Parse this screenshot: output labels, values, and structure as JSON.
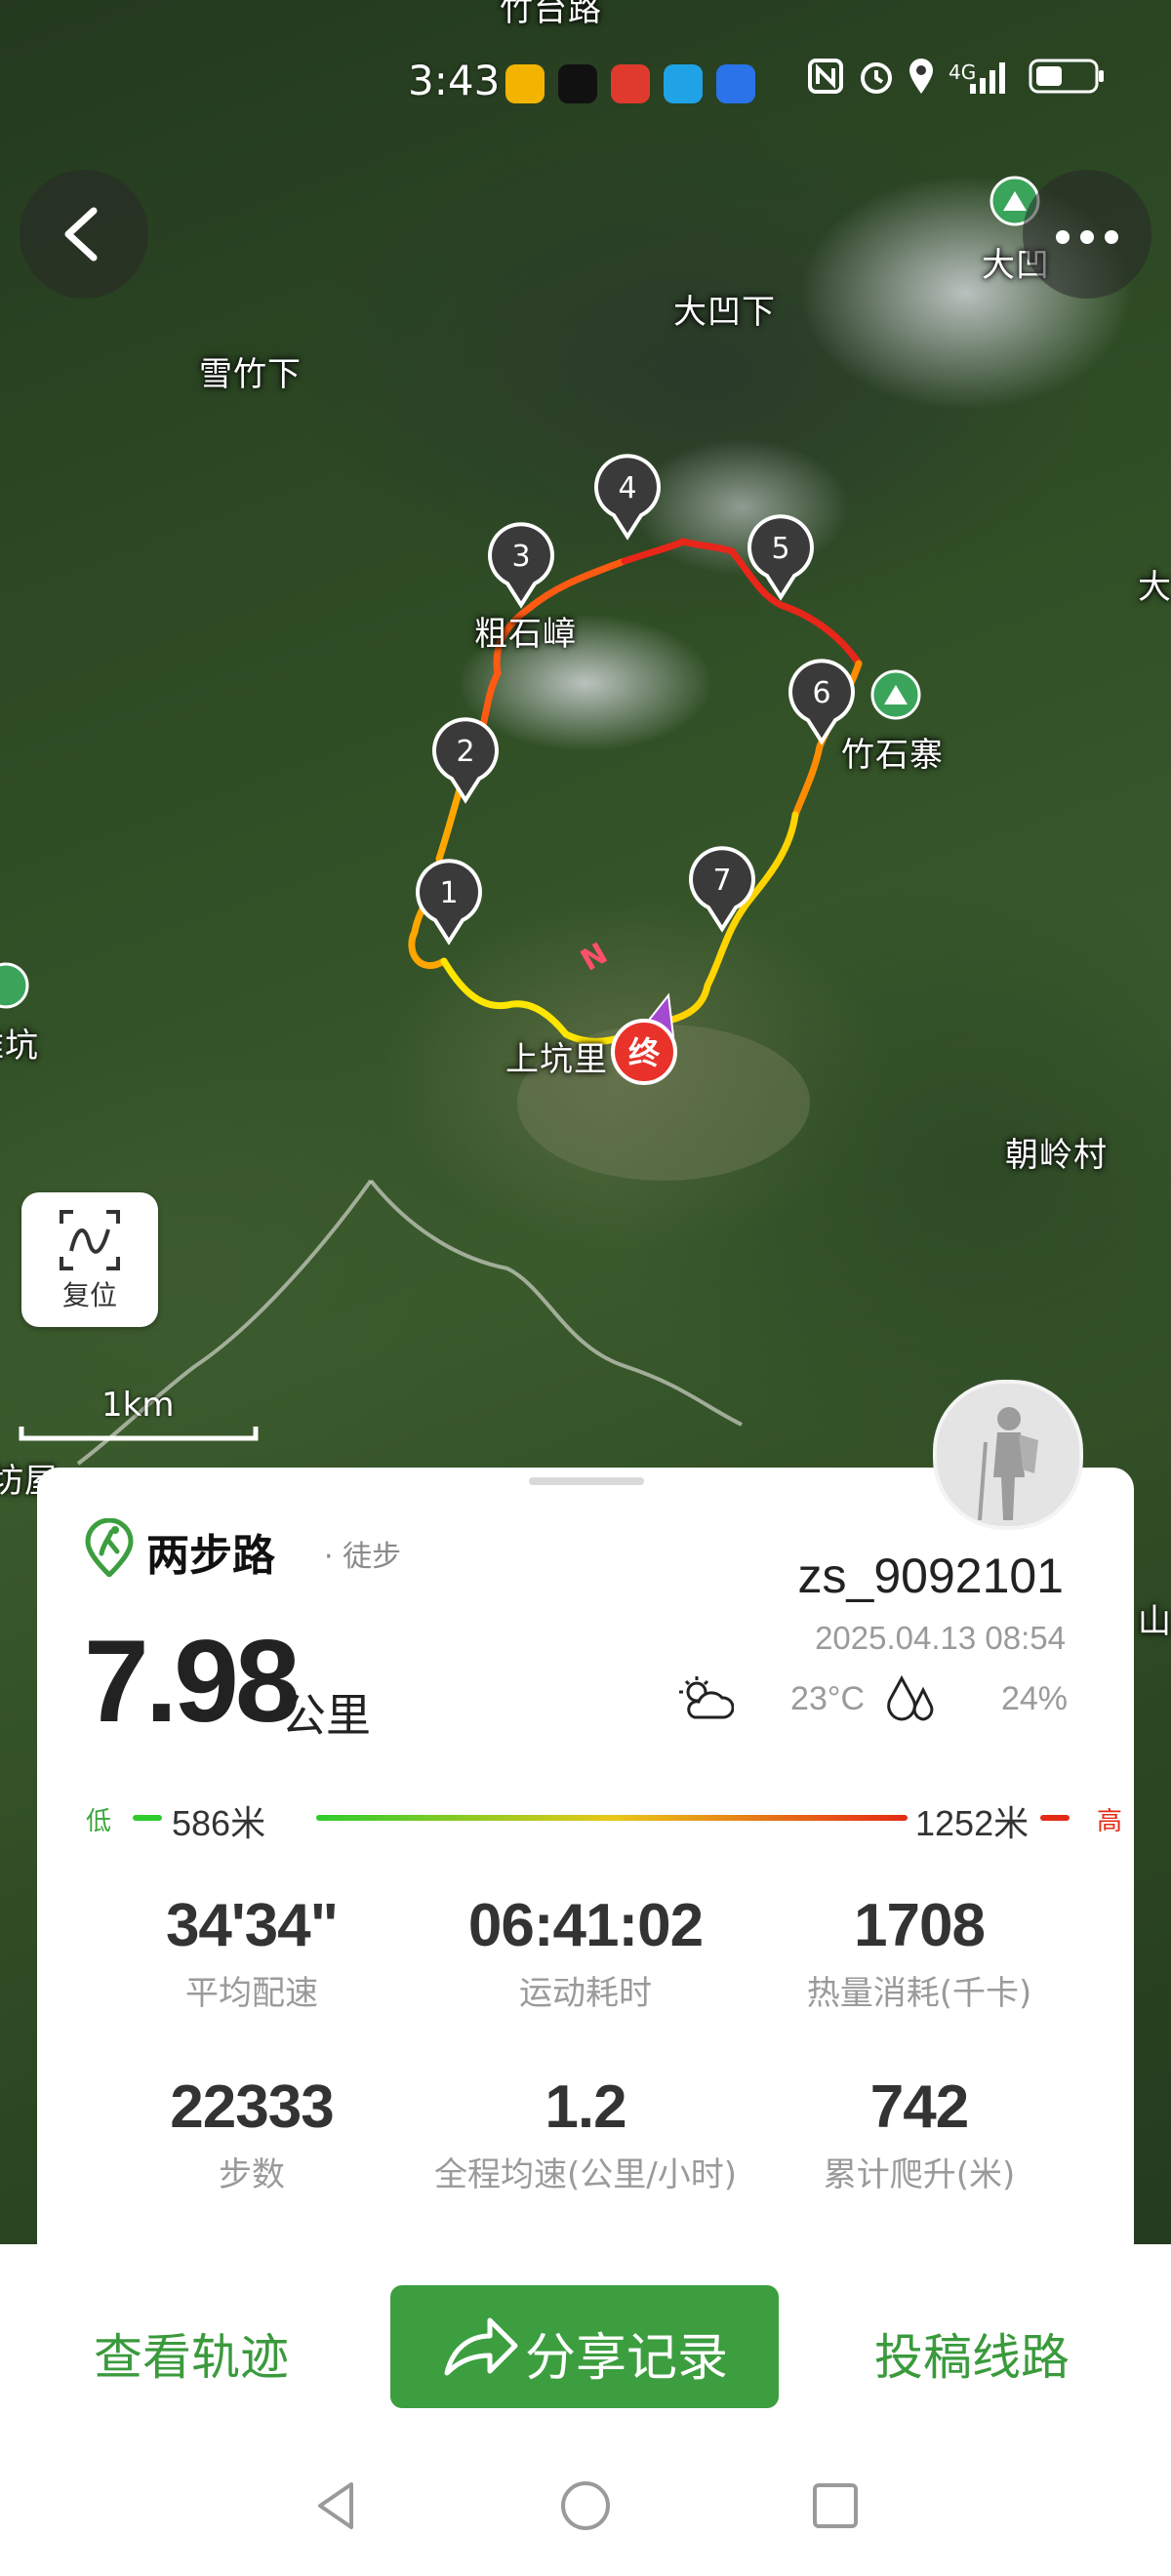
{
  "status_bar": {
    "time": "3:43",
    "network": "4G"
  },
  "map": {
    "labels": {
      "top_partial": "竹台路",
      "daaoxia": "大凹下",
      "xuezhuxia": "雪竹下",
      "daao_poi": "大凹",
      "da_edge": "大",
      "cushizhang": "粗石嶂",
      "zhushizhai": "竹石寨",
      "left_edge": "雅坑",
      "shangkeng": "上坑里",
      "chaolingcun": "朝岭村",
      "fangwu_edge": "坊屋",
      "shan_edge": "山"
    },
    "waypoints": [
      "1",
      "2",
      "3",
      "4",
      "5",
      "6",
      "7"
    ],
    "end_marker": "终",
    "reset_label": "复位",
    "scale_label": "1km"
  },
  "card": {
    "brand_name": "两步路",
    "activity_type": "· 徒步",
    "distance_value": "7.98",
    "distance_unit": "公里",
    "username": "zs_9092101",
    "datetime": "2025.04.13 08:54",
    "temperature": "23°C",
    "humidity": "24%",
    "elevation": {
      "low_tag": "低",
      "low_value": "586米",
      "high_value": "1252米",
      "high_tag": "高"
    },
    "stats": [
      {
        "value": "34'34\"",
        "label": "平均配速"
      },
      {
        "value": "06:41:02",
        "label": "运动耗时"
      },
      {
        "value": "1708",
        "label": "热量消耗(千卡)"
      },
      {
        "value": "22333",
        "label": "步数"
      },
      {
        "value": "1.2",
        "label": "全程均速(公里/小时)"
      },
      {
        "value": "742",
        "label": "累计爬升(米)"
      }
    ]
  },
  "bottom_bar": {
    "view_track": "查看轨迹",
    "share": "分享记录",
    "submit_route": "投稿线路"
  },
  "colors": {
    "brand_green": "#3c9e3f",
    "route_low": "#ffe400",
    "route_mid": "#ff9900",
    "route_high": "#ee2a16"
  }
}
